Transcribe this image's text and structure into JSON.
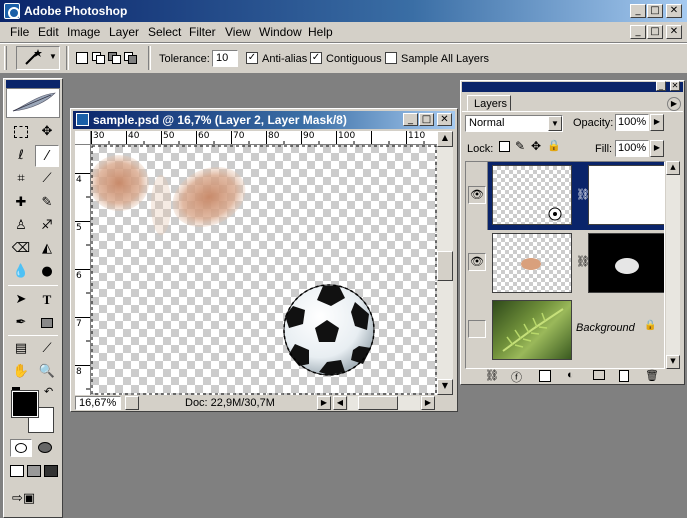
{
  "app": {
    "title": "Adobe Photoshop"
  },
  "menu": [
    "File",
    "Edit",
    "Image",
    "Layer",
    "Select",
    "Filter",
    "View",
    "Window",
    "Help"
  ],
  "options": {
    "tolerance_label": "Tolerance:",
    "tolerance_value": "10",
    "anti_alias_label": "Anti-alias",
    "contiguous_label": "Contiguous",
    "sample_all_label": "Sample All Layers"
  },
  "document": {
    "title": "sample.psd @ 16,7% (Layer 2, Layer Mask/8)",
    "ruler_top": [
      "30",
      "40",
      "50",
      "60",
      "70",
      "80",
      "90",
      "100",
      "110"
    ],
    "ruler_left": [
      "4",
      "5",
      "6",
      "7",
      "8"
    ],
    "zoom": "16,67%",
    "doc_size": "Doc: 22,9M/30,7M"
  },
  "layers_panel": {
    "tab": "Layers",
    "blend_mode": "Normal",
    "opacity_label": "Opacity:",
    "opacity_value": "100%",
    "lock_label": "Lock:",
    "fill_label": "Fill:",
    "fill_value": "100%",
    "background_label": "Background"
  },
  "colors": {
    "foreground": "#000000",
    "background": "#ffffff",
    "titlebar": "#0a246a"
  }
}
